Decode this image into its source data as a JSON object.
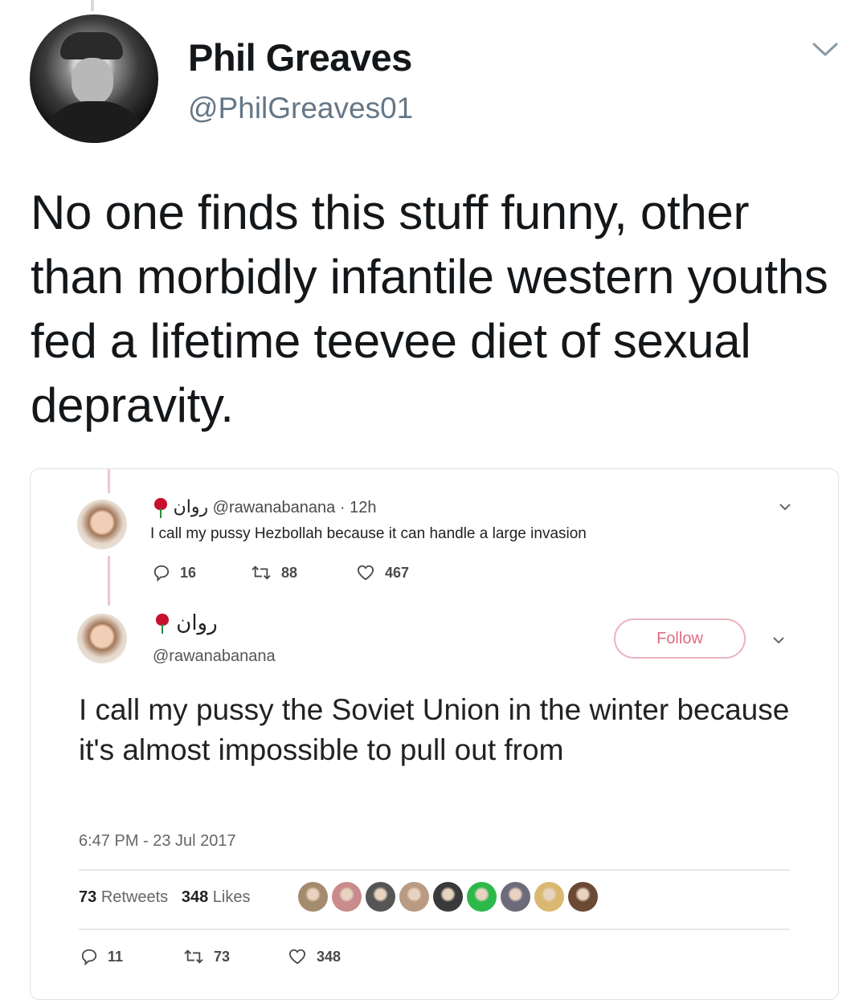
{
  "author": {
    "display_name": "Phil Greaves",
    "handle": "@PhilGreaves01"
  },
  "tweet": {
    "text": "No one finds this stuff funny, other than morbidly infantile western youths fed a lifetime teevee diet of sexual depravity."
  },
  "quoted": {
    "first": {
      "name": "روان",
      "handle": "@rawanabanana",
      "separator": "·",
      "time": "12h",
      "text": "I call my pussy Hezbollah because it can handle a large invasion",
      "replies": "16",
      "retweets": "88",
      "likes": "467"
    },
    "second": {
      "name": "روان",
      "handle": "@rawanabanana",
      "follow_label": "Follow",
      "text": "I call my pussy the Soviet Union in the winter because it's almost impossible to pull out from",
      "timestamp": "6:47 PM - 23 Jul 2017",
      "retweets_count": "73",
      "retweets_label": "Retweets",
      "likes_count": "348",
      "likes_label": "Likes",
      "replies": "11",
      "retweets": "73",
      "likes": "348"
    },
    "liker_colors": [
      "#a58b6d",
      "#c98b8b",
      "#555555",
      "#b99a82",
      "#3a3a3a",
      "#2db84a",
      "#6b6b7a",
      "#d9b870",
      "#6a4a33"
    ]
  },
  "colors": {
    "text": "#14171a",
    "secondary_text": "#657786",
    "follow_accent": "#e06c82",
    "rose": "#c8102e"
  },
  "icons": [
    "chevron-down-icon",
    "reply-icon",
    "retweet-icon",
    "like-icon",
    "rose-emoji-icon"
  ]
}
